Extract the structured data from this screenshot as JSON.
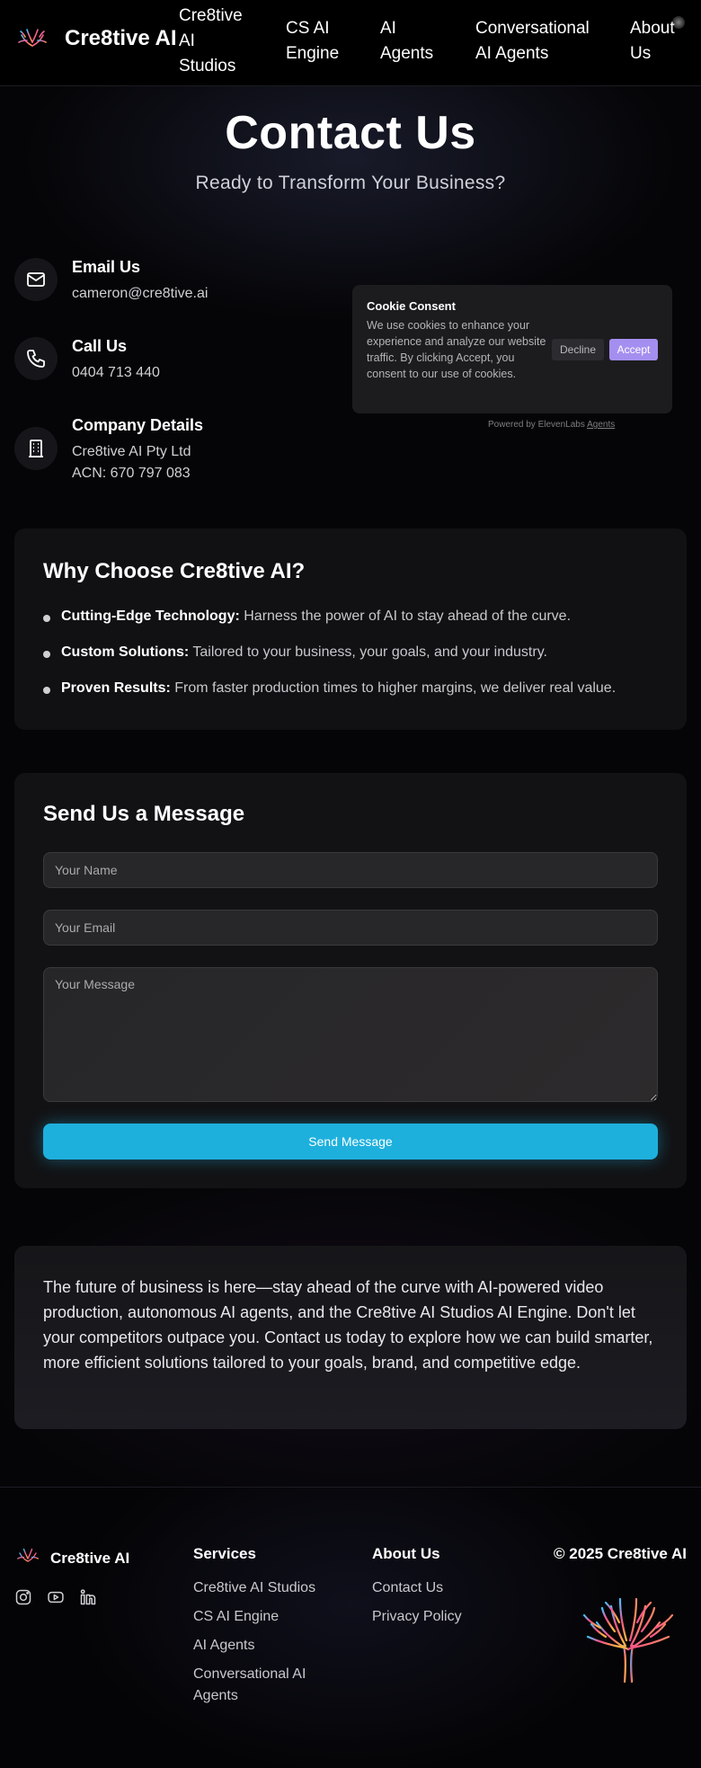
{
  "nav": {
    "brand": "Cre8tive AI",
    "links": [
      {
        "label": "Cre8tive AI Studios"
      },
      {
        "label": "CS AI Engine"
      },
      {
        "label": "AI Agents"
      },
      {
        "label": "Conversational AI Agents"
      },
      {
        "label": "About Us"
      }
    ]
  },
  "hero": {
    "title": "Contact Us",
    "subtitle": "Ready to Transform Your Business?"
  },
  "contact": {
    "email": {
      "title": "Email Us",
      "value": "cameron@cre8tive.ai",
      "icon": "mail-icon"
    },
    "call": {
      "title": "Call Us",
      "value": "0404 713 440",
      "icon": "phone-icon"
    },
    "company": {
      "title": "Company Details",
      "line1": "Cre8tive AI Pty Ltd",
      "line2": "ACN: 670 797 083",
      "icon": "building-icon"
    }
  },
  "cookie": {
    "title": "Cookie Consent",
    "body": "We use cookies to enhance your experience and analyze our website traffic. By clicking Accept, you consent to our use of cookies.",
    "decline": "Decline",
    "accept": "Accept",
    "powered_prefix": "Powered by ElevenLabs",
    "powered_link": "Agents"
  },
  "why": {
    "title": "Why Choose Cre8tive AI?",
    "items": [
      {
        "bold": "Cutting-Edge Technology:",
        "text": "Harness the power of AI to stay ahead of the curve."
      },
      {
        "bold": "Custom Solutions:",
        "text": "Tailored to your business, your goals, and your industry."
      },
      {
        "bold": "Proven Results:",
        "text": "From faster production times to higher margins, we deliver real value."
      }
    ]
  },
  "form": {
    "title": "Send Us a Message",
    "name_placeholder": "Your Name",
    "email_placeholder": "Your Email",
    "message_placeholder": "Your Message",
    "submit": "Send Message"
  },
  "future": {
    "text": "The future of business is here—stay ahead of the curve with AI-powered video production, autonomous AI agents, and the Cre8tive AI Studios AI Engine. Don't let your competitors outpace you. Contact us today to explore how we can build smarter, more efficient solutions tailored to your goals, brand, and competitive edge."
  },
  "footer": {
    "brand": "Cre8tive AI",
    "social": [
      "instagram-icon",
      "youtube-icon",
      "linkedin-icon"
    ],
    "services": {
      "heading": "Services",
      "links": [
        "Cre8tive AI Studios",
        "CS AI Engine",
        "AI Agents",
        "Conversational AI Agents"
      ]
    },
    "about": {
      "heading": "About Us",
      "links": [
        "Contact Us",
        "Privacy Policy"
      ]
    },
    "copyright": "© 2025 Cre8tive AI"
  },
  "colors": {
    "accent": "#1eb0dd",
    "cookie_accept": "#a48ff0",
    "background": "#050507"
  }
}
